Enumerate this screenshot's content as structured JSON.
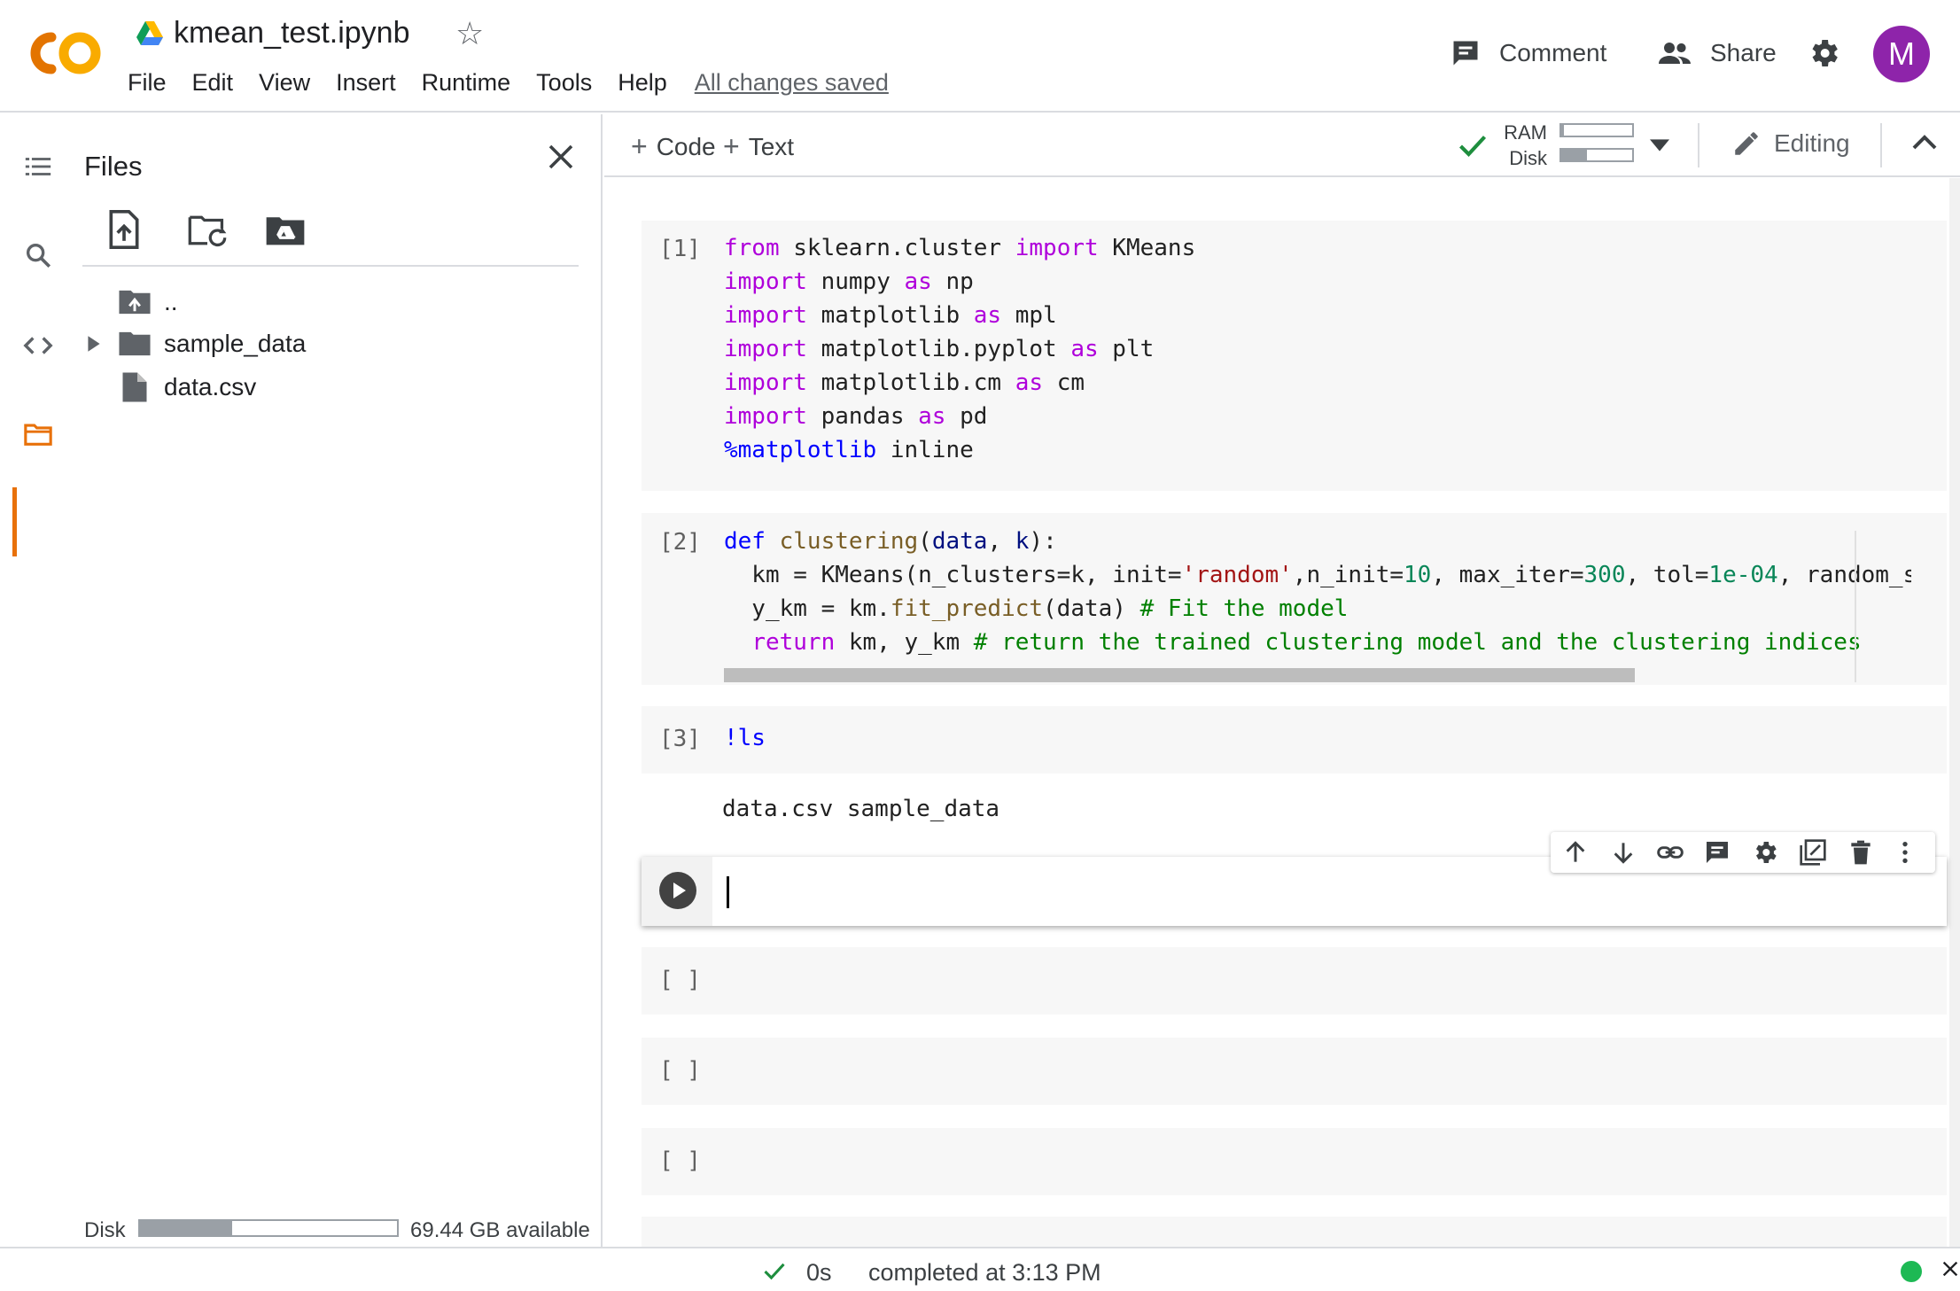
{
  "header": {
    "notebook_title": "kmean_test.ipynb",
    "menu": [
      "File",
      "Edit",
      "View",
      "Insert",
      "Runtime",
      "Tools",
      "Help"
    ],
    "saved_status": "All changes saved",
    "comment_label": "Comment",
    "share_label": "Share",
    "avatar_initial": "M",
    "colors": {
      "logo_orange": "#f9ab00",
      "logo_dark_orange": "#e37400",
      "avatar": "#8e24aa"
    }
  },
  "sidebar": {
    "rail_icons": [
      "toc-icon",
      "search-icon",
      "code-snippets-icon",
      "folder-icon",
      "terminal-icon"
    ],
    "files_title": "Files",
    "toolbar_icons": [
      "upload-file-icon",
      "refresh-folder-icon",
      "mount-drive-icon"
    ],
    "tree": [
      {
        "name": "..",
        "icon": "folder-up-icon"
      },
      {
        "name": "sample_data",
        "icon": "folder-icon",
        "expandable": true
      },
      {
        "name": "data.csv",
        "icon": "file-icon"
      }
    ],
    "disk_label": "Disk",
    "disk_used_fraction": 0.36,
    "disk_available": "69.44 GB available"
  },
  "toolbar": {
    "add_code": "Code",
    "add_text": "Text",
    "ram_label": "RAM",
    "disk_label": "Disk",
    "ram_used_fraction": 0.04,
    "disk_used_fraction": 0.36,
    "mode_label": "Editing"
  },
  "cells": [
    {
      "prompt": "[1]",
      "lines": [
        [
          [
            "kw",
            "from"
          ],
          [
            "t",
            " sklearn.cluster "
          ],
          [
            "kw",
            "import"
          ],
          [
            "t",
            " KMeans"
          ]
        ],
        [
          [
            "kw",
            "import"
          ],
          [
            "t",
            " numpy "
          ],
          [
            "kw",
            "as"
          ],
          [
            "t",
            " np"
          ]
        ],
        [
          [
            "kw",
            "import"
          ],
          [
            "t",
            " matplotlib "
          ],
          [
            "kw",
            "as"
          ],
          [
            "t",
            " mpl"
          ]
        ],
        [
          [
            "kw",
            "import"
          ],
          [
            "t",
            " matplotlib.pyplot "
          ],
          [
            "kw",
            "as"
          ],
          [
            "t",
            " plt"
          ]
        ],
        [
          [
            "kw",
            "import"
          ],
          [
            "t",
            " matplotlib.cm "
          ],
          [
            "kw",
            "as"
          ],
          [
            "t",
            " cm"
          ]
        ],
        [
          [
            "kw",
            "import"
          ],
          [
            "t",
            " pandas "
          ],
          [
            "kw",
            "as"
          ],
          [
            "t",
            " pd"
          ]
        ],
        [
          [
            "magic",
            "%matplotlib"
          ],
          [
            "t",
            " inline"
          ]
        ]
      ]
    },
    {
      "prompt": "[2]",
      "lines": [
        [
          [
            "kw2",
            "def"
          ],
          [
            "t",
            " "
          ],
          [
            "fn",
            "clustering"
          ],
          [
            "t",
            "("
          ],
          [
            "var",
            "data"
          ],
          [
            "t",
            ", "
          ],
          [
            "var",
            "k"
          ],
          [
            "t",
            "):"
          ]
        ],
        [
          [
            "t",
            "  km = KMeans(n_clusters=k, init="
          ],
          [
            "str",
            "'random'"
          ],
          [
            "t",
            ",n_init="
          ],
          [
            "num",
            "10"
          ],
          [
            "t",
            ", max_iter="
          ],
          [
            "num",
            "300"
          ],
          [
            "t",
            ", tol="
          ],
          [
            "num",
            "1e-04"
          ],
          [
            "t",
            ", random_stat"
          ]
        ],
        [
          [
            "t",
            "  y_km = km."
          ],
          [
            "fn",
            "fit_predict"
          ],
          [
            "t",
            "(data) "
          ],
          [
            "cmt",
            "# Fit the model"
          ]
        ],
        [
          [
            "t",
            "  "
          ],
          [
            "kw",
            "return"
          ],
          [
            "t",
            " km, y_km "
          ],
          [
            "cmt",
            "# return the trained clustering model and the clustering indices"
          ]
        ]
      ]
    },
    {
      "prompt": "[3]",
      "lines": [
        [
          [
            "magic",
            "!ls"
          ]
        ]
      ],
      "output": "data.csv  sample_data"
    }
  ],
  "empty_prompts": [
    "[ ]",
    "[ ]",
    "[ ]"
  ],
  "cell_toolbar_icons": [
    "move-up-icon",
    "move-down-icon",
    "link-icon",
    "comment-icon",
    "cell-settings-icon",
    "mirror-cell-icon",
    "delete-icon",
    "more-icon"
  ],
  "status": {
    "duration": "0s",
    "completed": "completed at 3:13 PM",
    "connected_color": "#1db954"
  }
}
